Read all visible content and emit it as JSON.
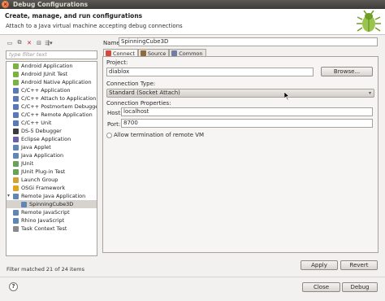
{
  "window": {
    "title": "Debug Configurations"
  },
  "header": {
    "title": "Create, manage, and run configurations",
    "subtitle": "Attach to a Java virtual machine accepting debug connections"
  },
  "left": {
    "filter_placeholder": "type filter text",
    "items": [
      {
        "label": "Android Application",
        "icon_color": "#7bb342"
      },
      {
        "label": "Android JUnit Test",
        "icon_color": "#7bb342"
      },
      {
        "label": "Android Native Application",
        "icon_color": "#7bb342"
      },
      {
        "label": "C/C++ Application",
        "icon_color": "#5a79b8"
      },
      {
        "label": "C/C++ Attach to Application",
        "icon_color": "#5a79b8"
      },
      {
        "label": "C/C++ Postmortem Debugger",
        "icon_color": "#5a79b8"
      },
      {
        "label": "C/C++ Remote Application",
        "icon_color": "#5a79b8"
      },
      {
        "label": "C/C++ Unit",
        "icon_color": "#5a79b8"
      },
      {
        "label": "DS-5 Debugger",
        "icon_color": "#3c3c3c"
      },
      {
        "label": "Eclipse Application",
        "icon_color": "#6d5fa8"
      },
      {
        "label": "Java Applet",
        "icon_color": "#5f87b4"
      },
      {
        "label": "Java Application",
        "icon_color": "#5f87b4"
      },
      {
        "label": "JUnit",
        "icon_color": "#6aa355"
      },
      {
        "label": "JUnit Plug-in Test",
        "icon_color": "#6aa355"
      },
      {
        "label": "Launch Group",
        "icon_color": "#d4a038"
      },
      {
        "label": "OSGi Framework",
        "icon_color": "#e0a520"
      },
      {
        "label": "Remote Java Application",
        "icon_color": "#5f87b4"
      },
      {
        "label": "SpinningCube3D",
        "icon_color": "#5f87b4"
      },
      {
        "label": "Remote JavaScript",
        "icon_color": "#5f87b4"
      },
      {
        "label": "Rhino JavaScript",
        "icon_color": "#5f87b4"
      },
      {
        "label": "Task Context Test",
        "icon_color": "#8a8a8a"
      }
    ],
    "status": "Filter matched 21 of 24 items"
  },
  "config": {
    "name_label": "Name:",
    "name_value": "SpinningCube3D",
    "tabs": [
      {
        "label": "Connect",
        "icon_color": "#d24a3a"
      },
      {
        "label": "Source",
        "icon_color": "#8d6b3a"
      },
      {
        "label": "Common",
        "icon_color": "#6f7fa0"
      }
    ],
    "project_label": "Project:",
    "project_value": "diablox",
    "browse_label": "Browse...",
    "connection_type_label": "Connection Type:",
    "connection_type_value": "Standard (Socket Attach)",
    "connection_props_label": "Connection Properties:",
    "host_label": "Host:",
    "host_value": "localhost",
    "port_label": "Port:",
    "port_value": "8700",
    "allow_terminate_label": "Allow termination of remote VM",
    "apply_label": "Apply",
    "revert_label": "Revert"
  },
  "footer": {
    "close_label": "Close",
    "debug_label": "Debug"
  }
}
